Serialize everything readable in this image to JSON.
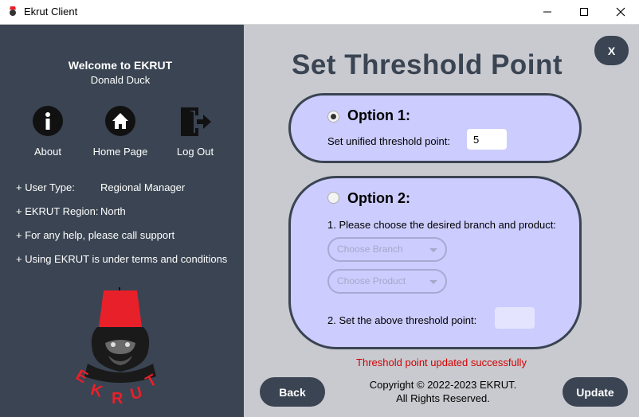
{
  "window": {
    "title": "Ekrut Client",
    "controls": {
      "minimize": "—",
      "maximize": "☐",
      "close": "✕"
    }
  },
  "sidebar": {
    "welcome": "Welcome to EKRUT",
    "user_name": "Donald Duck",
    "nav": [
      {
        "label": "About",
        "icon": "info-icon"
      },
      {
        "label": "Home Page",
        "icon": "home-icon"
      },
      {
        "label": "Log Out",
        "icon": "logout-icon"
      }
    ],
    "info": [
      {
        "label": "+ User Type:",
        "value": "Regional Manager"
      },
      {
        "label": "+ EKRUT Region:",
        "value": "North"
      },
      {
        "label": "+ For any help, please call support",
        "value": ""
      },
      {
        "label": "+ Using EKRUT is under terms and conditions",
        "value": ""
      }
    ],
    "logo_text": "EKRUT"
  },
  "main": {
    "title": "Set Threshold Point",
    "close_label": "X",
    "option1": {
      "label": "Option 1:",
      "selected": true,
      "field_label": "Set unified threshold point:",
      "field_value": "5"
    },
    "option2": {
      "label": "Option 2:",
      "selected": false,
      "step1": "1. Please choose the desired branch and product:",
      "branch_placeholder": "Choose Branch",
      "product_placeholder": "Choose Product",
      "step2": "2. Set the above threshold point:",
      "threshold_value": ""
    },
    "status": "Threshold point updated successfully",
    "copyright_line1": "Copyright © 2022-2023 EKRUT.",
    "copyright_line2": "All Rights Reserved.",
    "back_label": "Back",
    "update_label": "Update"
  },
  "colors": {
    "sidebar": "#3a4452",
    "main_bg": "#c8cacf",
    "panel": "#ccccff",
    "status": "#d40000",
    "logo_red": "#e8202a"
  }
}
